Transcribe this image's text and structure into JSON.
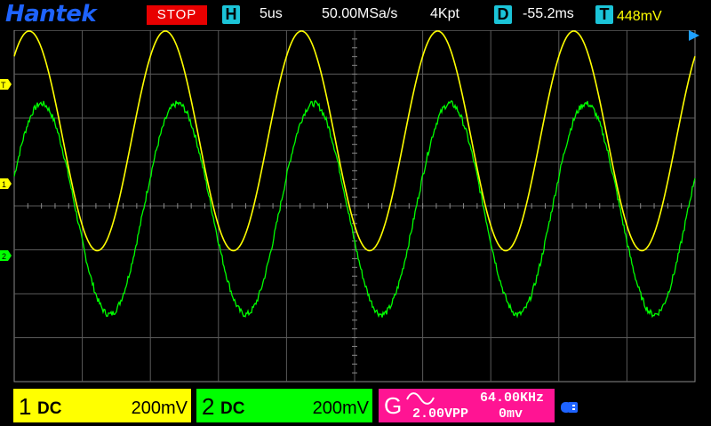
{
  "header": {
    "brand": "Hantek",
    "run_state": "STOP",
    "horizontal": {
      "tag": "H",
      "timebase": "5us",
      "sample_rate": "50.00MSa/s",
      "memory_depth": "4Kpt"
    },
    "delay": {
      "tag": "D",
      "value": "-55.2ms"
    },
    "trigger": {
      "tag": "T",
      "level": "448mV"
    }
  },
  "markers": {
    "trigger_level": "T",
    "ch1": "1",
    "ch2": "2"
  },
  "colors": {
    "ch1": "#ffff00",
    "ch2": "#00ff00",
    "gen": "#ff1493",
    "accent": "#1bc4d8",
    "brand": "#1e63ff",
    "stop": "#e80000"
  },
  "channels": [
    {
      "num": "1",
      "coupling": "DC",
      "scale": "200mV",
      "color": "#ffff00"
    },
    {
      "num": "2",
      "coupling": "DC",
      "scale": "200mV",
      "color": "#00ff00"
    }
  ],
  "generator": {
    "label": "G",
    "waveform": "sine",
    "frequency": "64.00KHz",
    "amplitude": "2.00VPP",
    "offset": "0mv"
  },
  "status_icons": {
    "usb": "usb-icon"
  },
  "waveform_data": {
    "time_per_div_us": 5,
    "screen_divisions": {
      "x": 10,
      "y": 8
    },
    "volts_per_div_mV": 200,
    "ch1": {
      "period_div": 2.0,
      "phase_peak_div": 0.22,
      "amplitude_div": 2.5,
      "offset_div": 1.48
    },
    "ch2": {
      "period_div": 2.0,
      "phase_peak_div": 0.4,
      "amplitude_div": 2.4,
      "offset_div": -0.07,
      "noise_div": 0.07
    }
  }
}
